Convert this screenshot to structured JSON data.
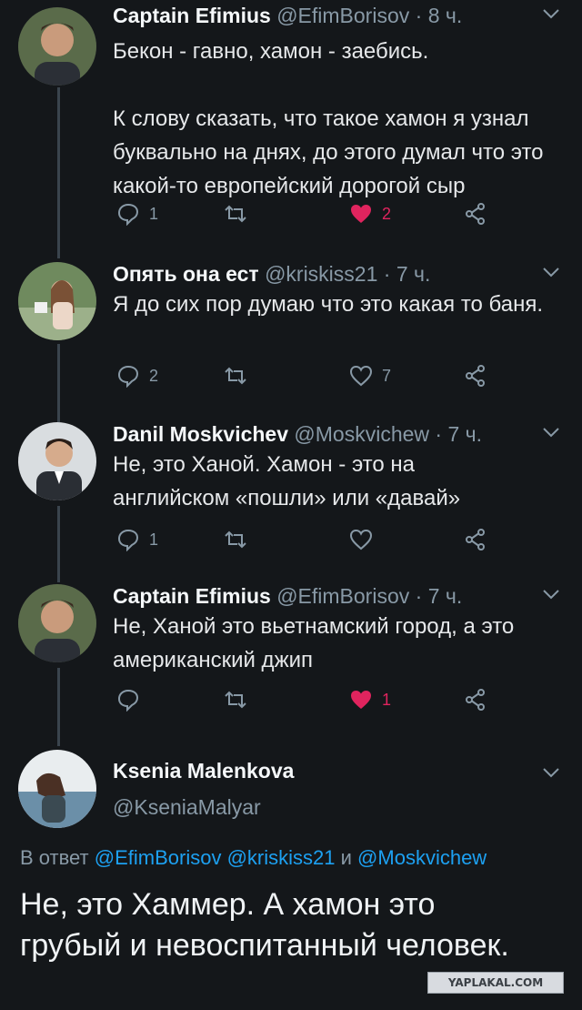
{
  "tweets": [
    {
      "name": "Captain Efimius",
      "handle": "@EfimBorisov",
      "time": "· 8 ч.",
      "text": "Бекон - гавно, хамон - заебись.\n\nК слову сказать, что такое хамон я узнал буквально на днях, до этого думал что это какой-то европейский дорогой сыр",
      "replies": "1",
      "retweets": "",
      "likes": "2",
      "liked": true
    },
    {
      "name": "Опять она ест",
      "handle": "@kriskiss21",
      "time": "· 7 ч.",
      "text": "Я до сих пор думаю что это какая то баня.",
      "replies": "2",
      "retweets": "",
      "likes": "7",
      "liked": false
    },
    {
      "name": "Danil Moskvichev",
      "handle": "@Moskvichew",
      "time": "· 7 ч.",
      "text": "Не, это Ханой. Хамон - это на английском «пошли» или «давай»",
      "replies": "1",
      "retweets": "",
      "likes": "",
      "liked": false
    },
    {
      "name": "Captain Efimius",
      "handle": "@EfimBorisov",
      "time": "· 7 ч.",
      "text": "Не, Ханой это вьетнамский город, а это американский джип",
      "replies": "",
      "retweets": "",
      "likes": "1",
      "liked": true
    }
  ],
  "main_tweet": {
    "name": "Ksenia Malenkova",
    "handle": "@KseniaMalyar",
    "reply_prefix": "В ответ",
    "mention_1": "@EfimBorisov",
    "mention_2": "@kriskiss21",
    "conjunction": "и",
    "mention_3": "@Moskvichew",
    "text": "Не, это Хаммер. А хамон это грубый и невоспитанный человек."
  },
  "watermark": "YAPLAKAL.COM",
  "colors": {
    "background": "#14171a",
    "secondary_text": "#8899a6",
    "link": "#1da1f2",
    "like": "#e0245e"
  }
}
